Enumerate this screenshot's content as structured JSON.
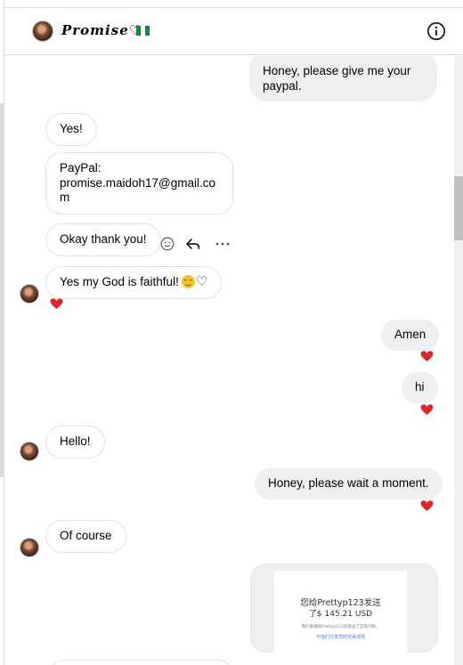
{
  "header": {
    "contact_name": "Promise",
    "name_heart": "♡",
    "flag": "nigeria-flag-icon"
  },
  "messages": {
    "m1": "Honey, please give me your paypal.",
    "m2": "Yes!",
    "m3": "PayPal:\npromise.maidoh17@gmail.co\nm",
    "m4": "Okay thank you!",
    "m5": "Yes my God is faithful!",
    "m6": "Amen",
    "m7": "hi",
    "m8": "Hello!",
    "m9": "Honey, please wait a moment.",
    "m10": "Of course"
  },
  "attachment": {
    "line1": "您给Prettyp123发送",
    "line2": "了$ 145.21 USD",
    "line3": "我们会通知Prettyp123您发送了这笔付款。",
    "line4": "与他们分享您的交易详情"
  },
  "colors": {
    "outgoing_bubble": "#efefef",
    "incoming_border": "#e1e1e1",
    "heart_red": "#e0242b",
    "flag_green": "#0b8a42"
  },
  "icons": {
    "info": "info-icon",
    "react": "smiley-icon",
    "reply": "reply-arrow-icon",
    "more": "more-dots-icon",
    "reaction": "red-heart-icon"
  }
}
